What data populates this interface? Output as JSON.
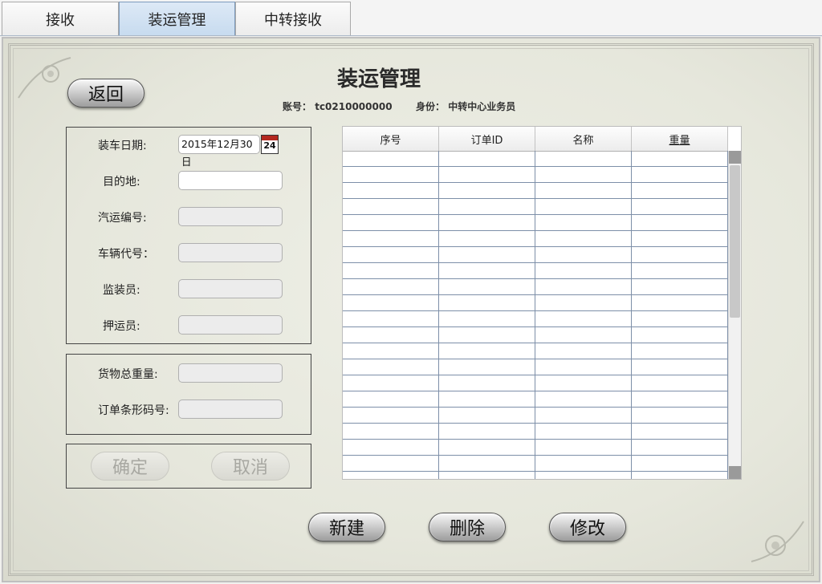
{
  "tabs": [
    {
      "label": "接收",
      "active": false
    },
    {
      "label": "装运管理",
      "active": true
    },
    {
      "label": "中转接收",
      "active": false
    }
  ],
  "page": {
    "title": "装运管理",
    "account_label": "账号：",
    "account_value": "tc0210000000",
    "identity_label": "身份：",
    "identity_value": "中转中心业务员",
    "back_label": "返回"
  },
  "form": {
    "load_date_label": "装车日期:",
    "load_date_value": "2015年12月30日",
    "calendar_day": "24",
    "destination_label": "目的地:",
    "truck_no_label": "汽运编号:",
    "vehicle_code_label": "车辆代号：",
    "supervisor_label": "监装员:",
    "escort_label": "押运员:",
    "total_weight_label": "货物总重量:",
    "barcode_label": "订单条形码号:",
    "confirm_label": "确定",
    "cancel_label": "取消"
  },
  "table": {
    "columns": [
      "序号",
      "订单ID",
      "名称",
      "重量"
    ],
    "sorted_column": "重量"
  },
  "actions": {
    "new_label": "新建",
    "delete_label": "删除",
    "modify_label": "修改"
  },
  "colors": {
    "active_tab": "#c7dbef",
    "background": "#e6e7dc",
    "calendar_red": "#b3281f"
  }
}
